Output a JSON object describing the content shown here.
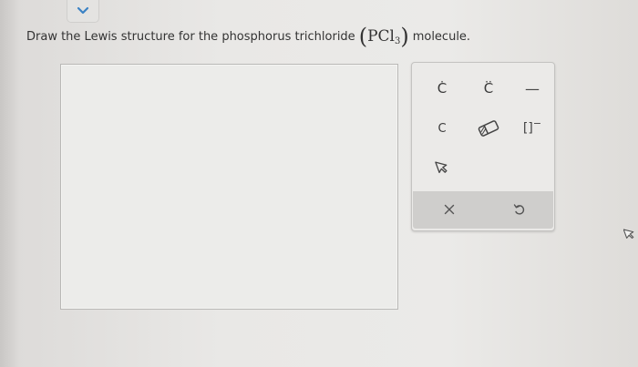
{
  "question": {
    "text_before": "Draw the Lewis structure for the phosphorus trichloride",
    "formula_base": "PCl",
    "formula_sub": "3",
    "text_after": "molecule."
  },
  "palette": {
    "radical_atom": "C",
    "lone_pair_atom": "C",
    "bond_symbol": "—",
    "plain_atom": "C",
    "bracket_symbol": "[]",
    "charge_symbol": "−"
  },
  "icons": {
    "toggle": "chevron-down-icon",
    "eraser": "eraser-icon",
    "pointer": "cursor-arrow-icon",
    "clear": "close-icon",
    "undo": "undo-icon"
  },
  "colors": {
    "accent": "#3b82c4",
    "action_bar": "#cfcecc"
  }
}
